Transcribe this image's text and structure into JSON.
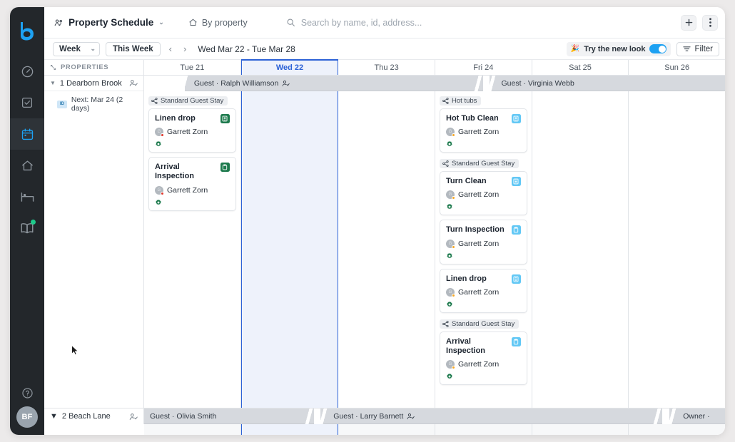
{
  "app": {
    "rail": {
      "logo": "bnb-logo",
      "items": [
        {
          "name": "dashboard",
          "icon": "gauge-icon",
          "active": false,
          "badge": false
        },
        {
          "name": "tasks",
          "icon": "checkbox-icon",
          "active": false,
          "badge": false
        },
        {
          "name": "schedule",
          "icon": "calendar-icon",
          "active": true,
          "badge": false
        },
        {
          "name": "properties",
          "icon": "home-icon",
          "active": false,
          "badge": false
        },
        {
          "name": "stays",
          "icon": "bed-icon",
          "active": false,
          "badge": false
        },
        {
          "name": "guidebook",
          "icon": "book-icon",
          "active": false,
          "badge": true
        }
      ],
      "help_label": "?",
      "avatar_initials": "BF"
    },
    "topbar": {
      "title": "Property Schedule",
      "title_caret": "⌄",
      "group_by_label": "By property",
      "search_placeholder": "Search by name, id, address...",
      "search_value": "",
      "add_label": "+",
      "more_label": "⋮"
    },
    "subbar": {
      "view_select": "Week",
      "view_caret": "⌄",
      "this_week_label": "This Week",
      "prev_label": "‹",
      "next_label": "›",
      "date_range": "Wed Mar 22 - Tue Mar 28",
      "new_look_label": "Try the new look",
      "new_look_emoji": "🎉",
      "new_look_on": true,
      "filter_label": "Filter"
    },
    "grid": {
      "properties_header": "PROPERTIES",
      "days": [
        {
          "label": "Tue 21",
          "today": false
        },
        {
          "label": "Wed 22",
          "today": true
        },
        {
          "label": "Thu 23",
          "today": false
        },
        {
          "label": "Fri 24",
          "today": false
        },
        {
          "label": "Sat 25",
          "today": false
        },
        {
          "label": "Sun 26",
          "today": false
        }
      ],
      "rows": [
        {
          "property": "1 Dearborn Brook",
          "next_badge": "ID",
          "next_text": "Next: Mar 24 (2 days)",
          "guests": [
            {
              "label": "Guest · Ralph Williamson",
              "start_pct": 7,
              "width_pct": 52,
              "has_icon": true
            },
            {
              "label": "Guest · Virginia Webb",
              "start_pct": 59,
              "width_pct": 41,
              "has_icon": false
            }
          ],
          "columns": [
            {
              "day": "Tue 21",
              "groups": [
                {
                  "label": "Standard Guest Stay",
                  "cards": [
                    {
                      "title": "Linen drop",
                      "badge": "linen-icon",
                      "badge_color": "green",
                      "user": "Garrett Zorn",
                      "status": "red"
                    },
                    {
                      "title": "Arrival Inspection",
                      "badge": "clipboard-icon",
                      "badge_color": "green",
                      "user": "Garrett Zorn",
                      "status": "red"
                    }
                  ]
                }
              ]
            },
            {
              "day": "Wed 22",
              "groups": []
            },
            {
              "day": "Thu 23",
              "groups": []
            },
            {
              "day": "Fri 24",
              "groups": [
                {
                  "label": "Hot tubs",
                  "cards": [
                    {
                      "title": "Hot Tub Clean",
                      "badge": "linen-icon",
                      "badge_color": "blue",
                      "user": "Garrett Zorn",
                      "status": "orange"
                    }
                  ]
                },
                {
                  "label": "Standard Guest Stay",
                  "cards": [
                    {
                      "title": "Turn Clean",
                      "badge": "linen-icon",
                      "badge_color": "blue",
                      "user": "Garrett Zorn",
                      "status": "orange"
                    },
                    {
                      "title": "Turn Inspection",
                      "badge": "clipboard-icon",
                      "badge_color": "blue",
                      "user": "Garrett Zorn",
                      "status": "orange"
                    },
                    {
                      "title": "Linen drop",
                      "badge": "linen-icon",
                      "badge_color": "blue",
                      "user": "Garrett Zorn",
                      "status": "orange"
                    }
                  ]
                },
                {
                  "label": "Standard Guest Stay",
                  "cards": [
                    {
                      "title": "Arrival Inspection",
                      "badge": "clipboard-icon",
                      "badge_color": "blue",
                      "user": "Garrett Zorn",
                      "status": "orange"
                    }
                  ]
                }
              ]
            },
            {
              "day": "Sat 25",
              "groups": []
            },
            {
              "day": "Sun 26",
              "groups": []
            }
          ]
        },
        {
          "property": "2 Beach Lane",
          "guests": [
            {
              "label": "Guest · Olivia Smith",
              "start_pct": 0,
              "width_pct": 28,
              "has_icon": false
            },
            {
              "label": "Guest · Larry Barnett",
              "start_pct": 30,
              "width_pct": 59,
              "has_icon": true
            },
            {
              "label": "Owner ·",
              "start_pct": 91,
              "width_pct": 9,
              "has_icon": false
            }
          ]
        }
      ]
    },
    "colors": {
      "accent_blue": "#2c62d6",
      "rail_bg": "#23272b",
      "logo_blue": "#1da1f2",
      "badge_green": "#1d7a4d",
      "badge_blue": "#63c8f5",
      "status_red": "#e0392e",
      "status_orange": "#f5a623",
      "today_bg": "#eef2fb",
      "guest_band": "#d6d9de"
    }
  }
}
